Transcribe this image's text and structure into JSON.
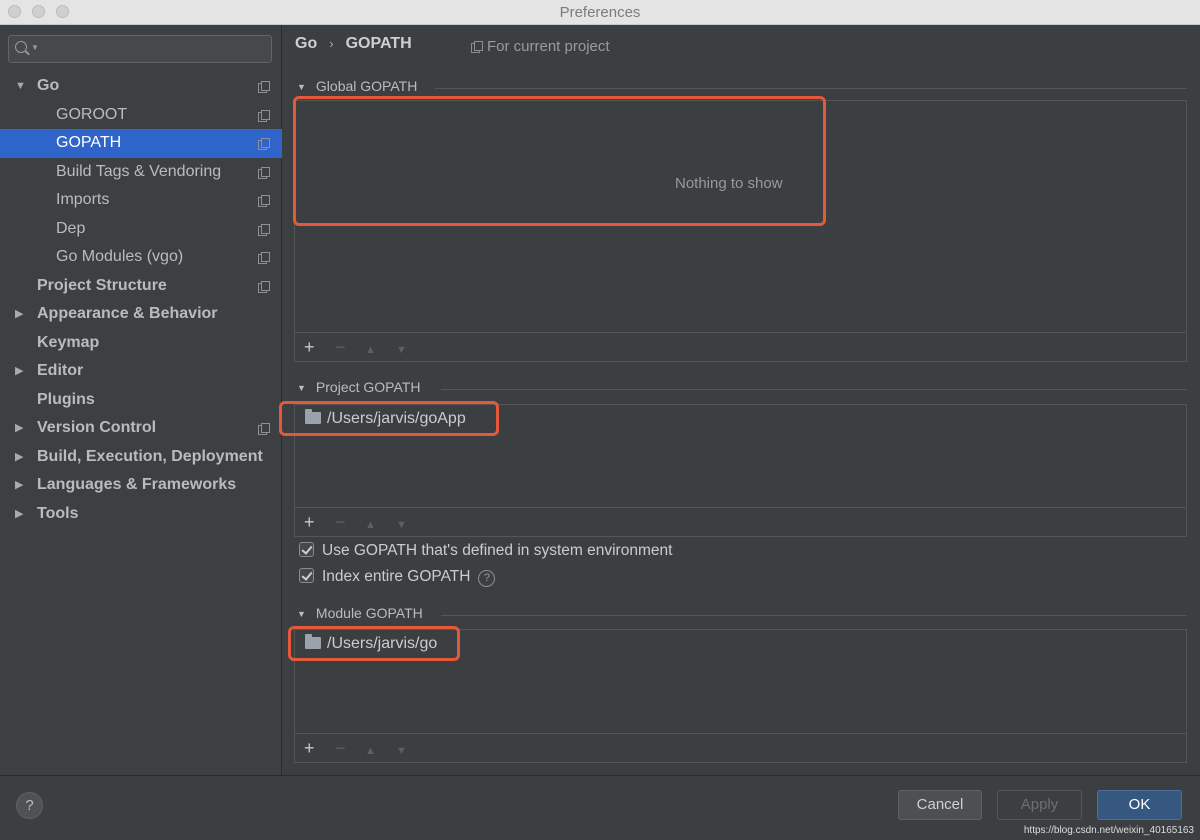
{
  "window": {
    "title": "Preferences"
  },
  "sidebar": {
    "items": [
      {
        "label": "Go",
        "arrow": "▼",
        "icon": true,
        "bold": true,
        "level": 0
      },
      {
        "label": "GOROOT",
        "arrow": "",
        "icon": true,
        "bold": false,
        "level": 1
      },
      {
        "label": "GOPATH",
        "arrow": "",
        "icon": true,
        "bold": false,
        "level": 1,
        "selected": true
      },
      {
        "label": "Build Tags & Vendoring",
        "arrow": "",
        "icon": true,
        "bold": false,
        "level": 1
      },
      {
        "label": "Imports",
        "arrow": "",
        "icon": true,
        "bold": false,
        "level": 1
      },
      {
        "label": "Dep",
        "arrow": "",
        "icon": true,
        "bold": false,
        "level": 1
      },
      {
        "label": "Go Modules (vgo)",
        "arrow": "",
        "icon": true,
        "bold": false,
        "level": 1
      },
      {
        "label": "Project Structure",
        "arrow": "",
        "icon": true,
        "bold": true,
        "level": 0
      },
      {
        "label": "Appearance & Behavior",
        "arrow": "▶",
        "icon": false,
        "bold": true,
        "level": 0
      },
      {
        "label": "Keymap",
        "arrow": "",
        "icon": false,
        "bold": true,
        "level": 0
      },
      {
        "label": "Editor",
        "arrow": "▶",
        "icon": false,
        "bold": true,
        "level": 0
      },
      {
        "label": "Plugins",
        "arrow": "",
        "icon": false,
        "bold": true,
        "level": 0
      },
      {
        "label": "Version Control",
        "arrow": "▶",
        "icon": true,
        "bold": true,
        "level": 0
      },
      {
        "label": "Build, Execution, Deployment",
        "arrow": "▶",
        "icon": false,
        "bold": true,
        "level": 0
      },
      {
        "label": "Languages & Frameworks",
        "arrow": "▶",
        "icon": false,
        "bold": true,
        "level": 0
      },
      {
        "label": "Tools",
        "arrow": "▶",
        "icon": false,
        "bold": true,
        "level": 0
      }
    ]
  },
  "header": {
    "crumb_parent": "Go",
    "crumb_sep": "›",
    "crumb_current": "GOPATH",
    "scope_label": "For current project"
  },
  "global_gopath": {
    "title": "Global GOPATH",
    "empty_text": "Nothing to show"
  },
  "project_gopath": {
    "title": "Project GOPATH",
    "entries": [
      "/Users/jarvis/goApp"
    ]
  },
  "options": {
    "use_system_gopath_label": "Use GOPATH that's defined in system environment",
    "use_system_gopath_checked": true,
    "index_entire_label": "Index entire GOPATH",
    "index_entire_checked": true,
    "help_glyph": "?"
  },
  "module_gopath": {
    "title": "Module GOPATH",
    "entries": [
      "/Users/jarvis/go"
    ]
  },
  "toolbar": {
    "add": "+",
    "remove": "−",
    "up": "▲",
    "down": "▼"
  },
  "footer": {
    "help": "?",
    "cancel": "Cancel",
    "apply": "Apply",
    "ok": "OK",
    "watermark": "https://blog.csdn.net/weixin_40165163"
  },
  "colors": {
    "selection": "#2f65ca",
    "highlight": "#e4593a",
    "primary_button": "#365880"
  }
}
